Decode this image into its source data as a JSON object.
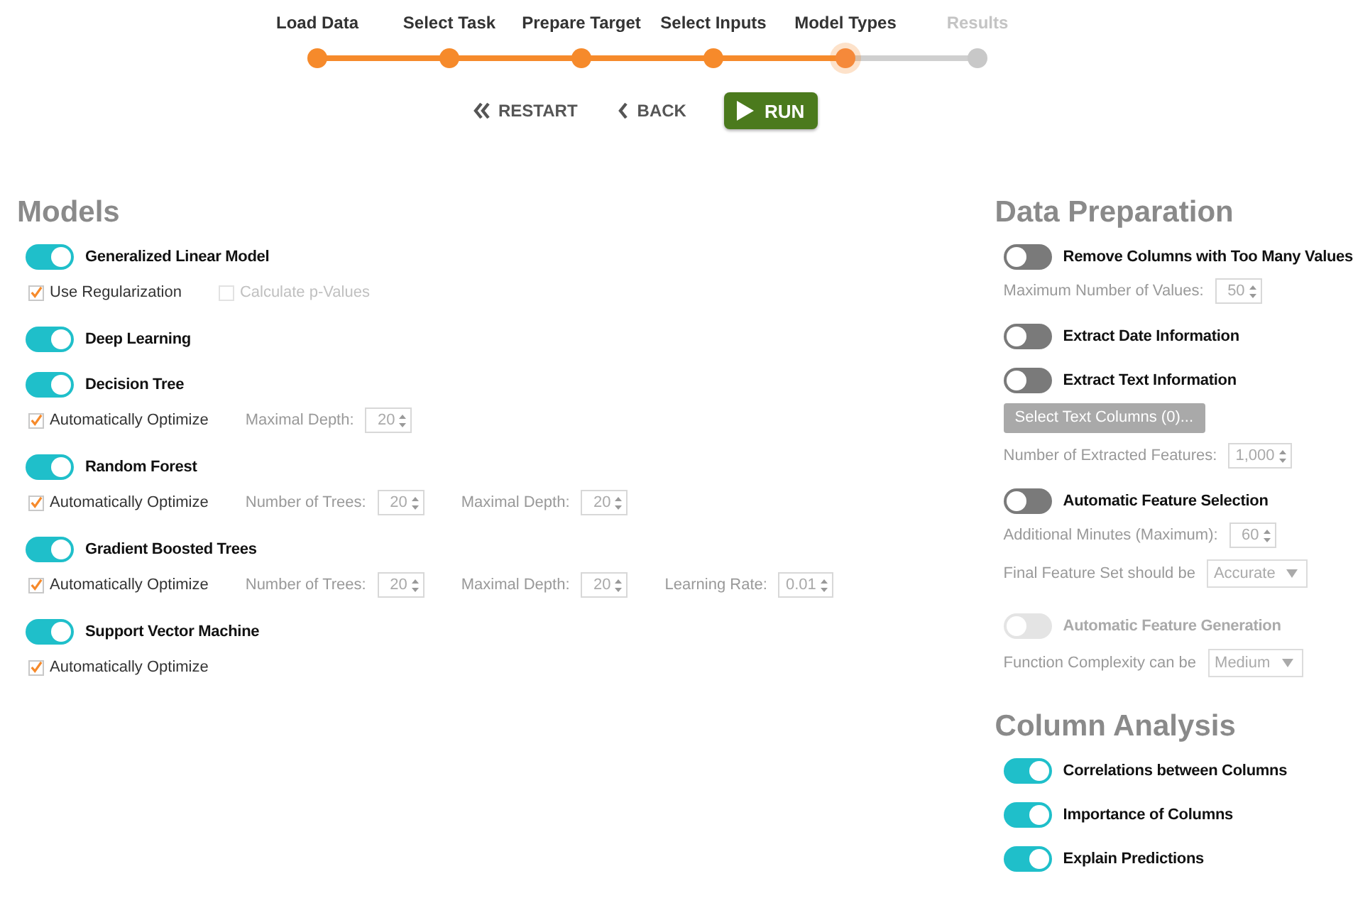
{
  "steps": [
    {
      "label": "Load Data",
      "done": true,
      "selected": false
    },
    {
      "label": "Select Task",
      "done": true,
      "selected": false
    },
    {
      "label": "Prepare Target",
      "done": true,
      "selected": false
    },
    {
      "label": "Select Inputs",
      "done": true,
      "selected": false
    },
    {
      "label": "Model Types",
      "done": false,
      "selected": true
    },
    {
      "label": "Results",
      "done": false,
      "selected": false
    }
  ],
  "actions": [
    {
      "kind": "restart",
      "label": "RESTART"
    },
    {
      "kind": "back",
      "label": "BACK"
    },
    {
      "kind": "run",
      "label": "RUN"
    }
  ],
  "models": {
    "title": "Models",
    "items": [
      {
        "label": "Generalized Linear Model",
        "on": true,
        "options": [
          {
            "kind": "checkbox",
            "label": "Use Regularization",
            "checked": true,
            "disabled": false
          },
          {
            "kind": "checkbox",
            "label": "Calculate p-Values",
            "checked": false,
            "disabled": true
          }
        ]
      },
      {
        "label": "Deep Learning",
        "on": true
      },
      {
        "label": "Decision Tree",
        "on": true,
        "options": [
          {
            "kind": "checkbox",
            "label": "Automatically Optimize",
            "checked": true,
            "disabled": false
          },
          {
            "kind": "spinner",
            "label": "Maximal Depth:",
            "value": "20",
            "disabled": true
          }
        ]
      },
      {
        "label": "Random Forest",
        "on": true,
        "options": [
          {
            "kind": "checkbox",
            "label": "Automatically Optimize",
            "checked": true,
            "disabled": false
          },
          {
            "kind": "spinner",
            "label": "Number of Trees:",
            "value": "20",
            "disabled": true
          },
          {
            "kind": "spinner",
            "label": "Maximal Depth:",
            "value": "20",
            "disabled": true
          }
        ]
      },
      {
        "label": "Gradient Boosted Trees",
        "on": true,
        "options": [
          {
            "kind": "checkbox",
            "label": "Automatically Optimize",
            "checked": true,
            "disabled": false
          },
          {
            "kind": "spinner",
            "label": "Number of Trees:",
            "value": "20",
            "disabled": true
          },
          {
            "kind": "spinner",
            "label": "Maximal Depth:",
            "value": "20",
            "disabled": true
          },
          {
            "kind": "spinner",
            "label": "Learning Rate:",
            "value": "0.01",
            "disabled": true
          }
        ]
      },
      {
        "label": "Support Vector Machine",
        "on": true,
        "options": [
          {
            "kind": "checkbox",
            "label": "Automatically Optimize",
            "checked": true,
            "disabled": false
          }
        ]
      }
    ]
  },
  "data_preparation": {
    "title": "Data Preparation",
    "items": [
      {
        "kind": "toggle",
        "label": "Remove Columns with Too Many Values",
        "on": false,
        "disabled": false
      },
      {
        "kind": "spinner",
        "label": "Maximum Number of Values:",
        "value": "50",
        "disabled": true
      },
      {
        "kind": "toggle",
        "label": "Extract Date Information",
        "on": false,
        "disabled": false
      },
      {
        "kind": "toggle",
        "label": "Extract Text Information",
        "on": false,
        "disabled": false
      },
      {
        "kind": "button",
        "label": "Select Text Columns (0)...",
        "disabled": true
      },
      {
        "kind": "spinner",
        "label": "Number of Extracted Features:",
        "value": "1,000",
        "disabled": true
      },
      {
        "kind": "toggle",
        "label": "Automatic Feature Selection",
        "on": false,
        "disabled": false
      },
      {
        "kind": "spinner",
        "label": "Additional Minutes (Maximum):",
        "value": "60",
        "disabled": true
      },
      {
        "kind": "dropdown",
        "label": "Final Feature Set should be",
        "value": "Accurate",
        "disabled": true
      },
      {
        "kind": "toggle",
        "label": "Automatic Feature Generation",
        "on": false,
        "disabled": true
      },
      {
        "kind": "dropdown",
        "label": "Function Complexity can be",
        "value": "Medium",
        "disabled": true
      }
    ]
  },
  "column_analysis": {
    "title": "Column Analysis",
    "items": [
      {
        "kind": "toggle",
        "label": "Correlations between Columns",
        "on": true,
        "disabled": false
      },
      {
        "kind": "toggle",
        "label": "Importance of Columns",
        "on": true,
        "disabled": false
      },
      {
        "kind": "toggle",
        "label": "Explain Predictions",
        "on": true,
        "disabled": false
      }
    ]
  }
}
